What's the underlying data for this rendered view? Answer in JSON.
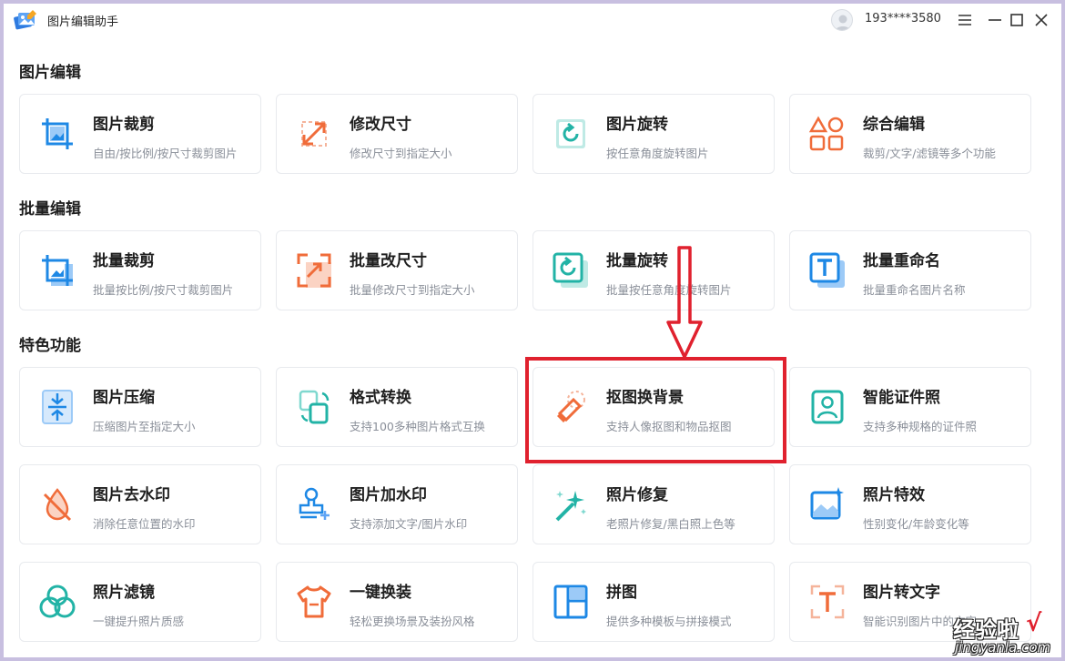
{
  "app": {
    "title": "图片编辑助手",
    "user_phone": "193****3580",
    "logo_icon": "app-logo-icon",
    "accent": "#1e88e5",
    "orange": "#f06c3a",
    "teal": "#22b3a6"
  },
  "sections": [
    {
      "title": "图片编辑",
      "cards": [
        {
          "title": "图片裁剪",
          "desc": "自由/按比例/按尺寸裁剪图片",
          "icon": "crop-icon"
        },
        {
          "title": "修改尺寸",
          "desc": "修改尺寸到指定大小",
          "icon": "resize-icon"
        },
        {
          "title": "图片旋转",
          "desc": "按任意角度旋转图片",
          "icon": "rotate-icon"
        },
        {
          "title": "综合编辑",
          "desc": "裁剪/文字/滤镜等多个功能",
          "icon": "shapes-icon"
        }
      ]
    },
    {
      "title": "批量编辑",
      "cards": [
        {
          "title": "批量裁剪",
          "desc": "批量按比例/按尺寸裁剪图片",
          "icon": "batch-crop-icon"
        },
        {
          "title": "批量改尺寸",
          "desc": "批量修改尺寸到指定大小",
          "icon": "batch-resize-icon"
        },
        {
          "title": "批量旋转",
          "desc": "批量按任意角度旋转图片",
          "icon": "batch-rotate-icon"
        },
        {
          "title": "批量重命名",
          "desc": "批量重命名图片名称",
          "icon": "rename-icon"
        }
      ]
    },
    {
      "title": "特色功能",
      "cards": [
        {
          "title": "图片压缩",
          "desc": "压缩图片至指定大小",
          "icon": "compress-icon"
        },
        {
          "title": "格式转换",
          "desc": "支持100多种图片格式互换",
          "icon": "convert-icon"
        },
        {
          "title": "抠图换背景",
          "desc": "支持人像抠图和物品抠图",
          "icon": "eraser-icon"
        },
        {
          "title": "智能证件照",
          "desc": "支持多种规格的证件照",
          "icon": "id-photo-icon"
        },
        {
          "title": "图片去水印",
          "desc": "消除任意位置的水印",
          "icon": "remove-watermark-icon"
        },
        {
          "title": "图片加水印",
          "desc": "支持添加文字/图片水印",
          "icon": "stamp-icon"
        },
        {
          "title": "照片修复",
          "desc": "老照片修复/黑白照上色等",
          "icon": "magic-wand-icon"
        },
        {
          "title": "照片特效",
          "desc": "性别变化/年龄变化等",
          "icon": "photo-effect-icon"
        },
        {
          "title": "照片滤镜",
          "desc": "一键提升照片质感",
          "icon": "filter-icon"
        },
        {
          "title": "一键换装",
          "desc": "轻松更换场景及装扮风格",
          "icon": "tshirt-icon"
        },
        {
          "title": "拼图",
          "desc": "提供多种模板与拼接模式",
          "icon": "collage-icon"
        },
        {
          "title": "图片转文字",
          "desc": "智能识别图片中的文字",
          "icon": "ocr-icon"
        }
      ]
    }
  ],
  "watermark": {
    "main": "经验啦",
    "check": "√",
    "sub": "jingyanla.com"
  }
}
